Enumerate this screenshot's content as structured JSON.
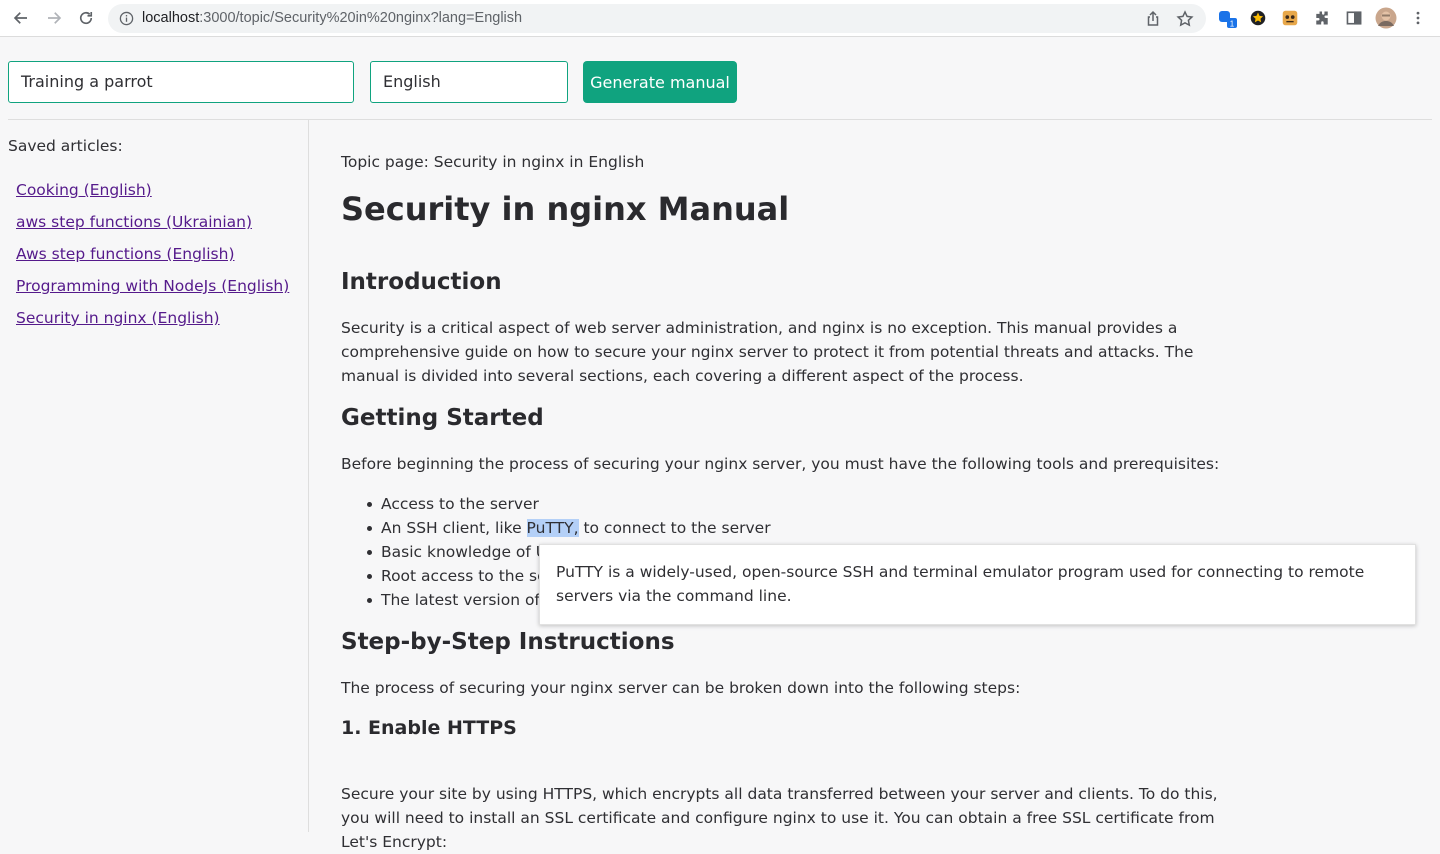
{
  "browser": {
    "url_host": "localhost",
    "url_path": ":3000/topic/Security%20in%20nginx?lang=English",
    "extension_badge": "1"
  },
  "form": {
    "topic_value": "Training a parrot",
    "language_value": "English",
    "generate_label": "Generate manual"
  },
  "sidebar": {
    "heading": "Saved articles:",
    "items": [
      {
        "label": "Cooking (English)"
      },
      {
        "label": "aws step functions (Ukrainian)"
      },
      {
        "label": "Aws step functions (English)"
      },
      {
        "label": "Programming with NodeJs (English)"
      },
      {
        "label": "Security in nginx (English)"
      }
    ]
  },
  "article": {
    "topic_line": "Topic page: Security in nginx in English",
    "title": "Security in nginx Manual",
    "intro_heading": "Introduction",
    "intro_text": "Security is a critical aspect of web server administration, and nginx is no exception. This manual provides a comprehensive guide on how to secure your nginx server to protect it from potential threats and attacks. The manual is divided into several sections, each covering a different aspect of the process.",
    "getting_started_heading": "Getting Started",
    "getting_started_text": "Before beginning the process of securing your nginx server, you must have the following tools and prerequisites:",
    "bullets": {
      "b1": "Access to the server",
      "b2_pre": "An SSH client, like ",
      "b2_hl": "PuTTY,",
      "b2_post": " to connect to the server",
      "b3": "Basic knowledge of U",
      "b4": "Root access to the se",
      "b5": "The latest version of n"
    },
    "steps_heading": "Step-by-Step Instructions",
    "steps_text": "The process of securing your nginx server can be broken down into the following steps:",
    "https_heading": "1. Enable HTTPS",
    "https_text": "Secure your site by using HTTPS, which encrypts all data transferred between your server and clients. To do this, you will need to install an SSL certificate and configure nginx to use it. You can obtain a free SSL certificate from Let's Encrypt:"
  },
  "tooltip": {
    "text": "PuTTY is a widely-used, open-source SSH and terminal emulator program used for connecting to remote servers via the command line."
  },
  "icons": [
    "back-arrow-icon",
    "forward-arrow-icon",
    "reload-icon",
    "info-icon",
    "share-icon",
    "bookmark-star-icon",
    "extension-icon",
    "puzzle-icon",
    "sidepanel-icon",
    "profile-avatar",
    "kebab-menu-icon"
  ],
  "colors": {
    "accent": "#10a37f",
    "link_visited": "#551a8b",
    "highlight": "#b4d0f7"
  }
}
